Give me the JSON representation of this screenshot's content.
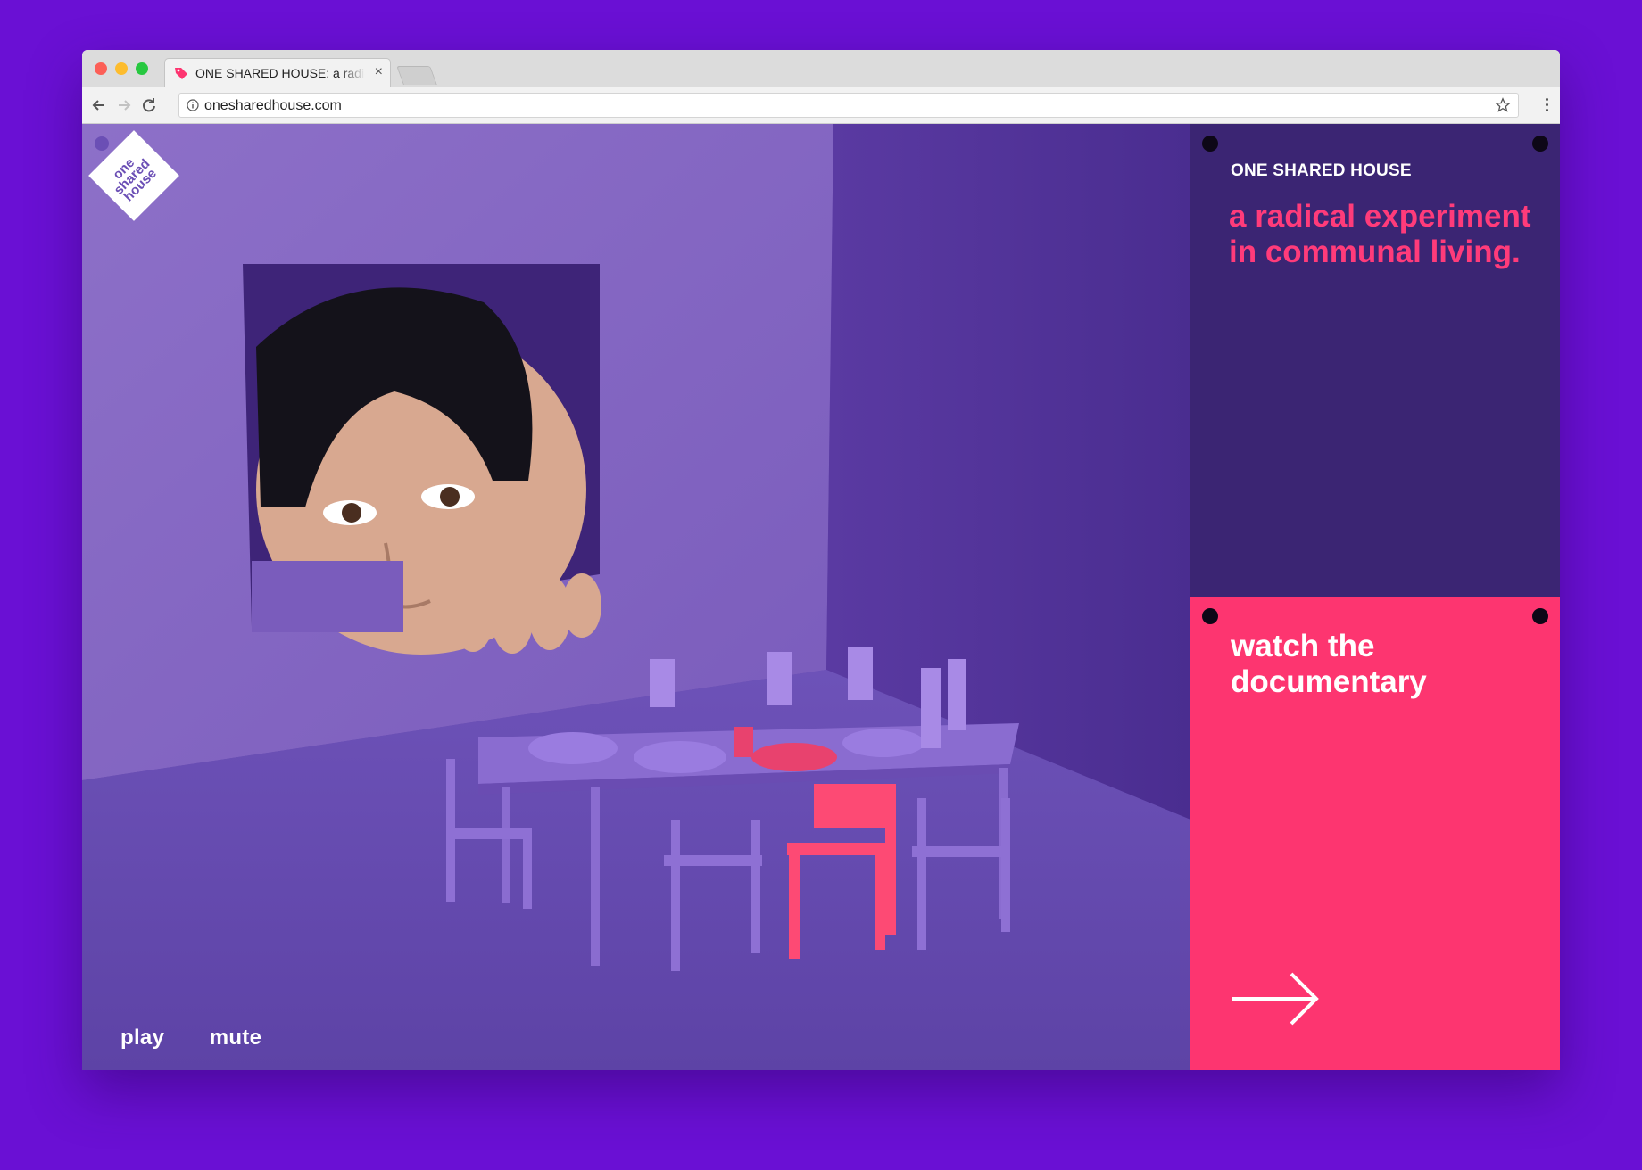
{
  "browser": {
    "tab_title": "ONE SHARED HOUSE: a radical experiment in communal living.",
    "tab_close": "×",
    "url": "onesharedhouse.com"
  },
  "logo": {
    "lines": [
      "one",
      "shared",
      "house"
    ]
  },
  "controls": {
    "play": "play",
    "mute": "mute"
  },
  "intro": {
    "brand": "ONE SHARED HOUSE",
    "tagline": "a radical experiment in communal living."
  },
  "cta": {
    "label": "watch the documentary"
  },
  "colors": {
    "page_bg": "#6a10d4",
    "panel_dark": "#3b2573",
    "panel_pink": "#fd3570",
    "tagline_pink": "#ff3b7a"
  }
}
